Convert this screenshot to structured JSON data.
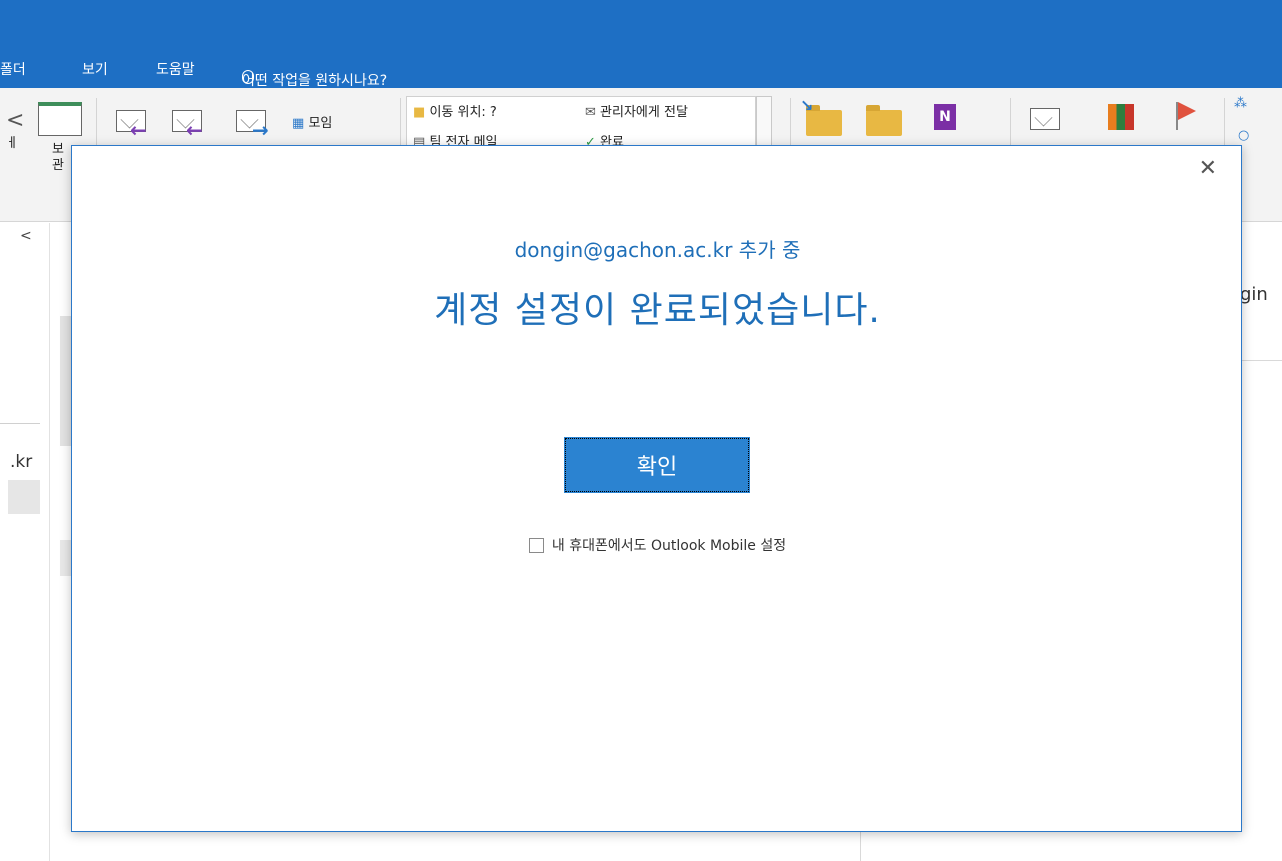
{
  "menubar": {
    "items": [
      "폴더",
      "보기",
      "도움말"
    ],
    "tell_me": "어떤 작업을 원하시나요?"
  },
  "ribbon": {
    "left_label_1": "보",
    "left_label_2": "관",
    "left_label_0": "ㅔ",
    "meeting": "모임",
    "quickstep_move": "이동 위치: ?",
    "quickstep_team": "팀 전자 메일",
    "quickstep_forward": "관리자에게 전달",
    "quickstep_done": "완료"
  },
  "left_pane": {
    "collapse_glyph": "<",
    "account_fragment": ".kr"
  },
  "right_pane": {
    "fragment": "gin"
  },
  "dialog": {
    "close_glyph": "✕",
    "adding_text": "dongin@gachon.ac.kr 추가 중",
    "done_text": "계정 설정이 완료되었습니다.",
    "ok_label": "확인",
    "mobile_checkbox_label": "내 휴대폰에서도 Outlook Mobile 설정",
    "mobile_checkbox_checked": false
  },
  "colors": {
    "titlebar": "#1e6fc4",
    "accent_text": "#1f6fb8",
    "button": "#2b83d1"
  }
}
